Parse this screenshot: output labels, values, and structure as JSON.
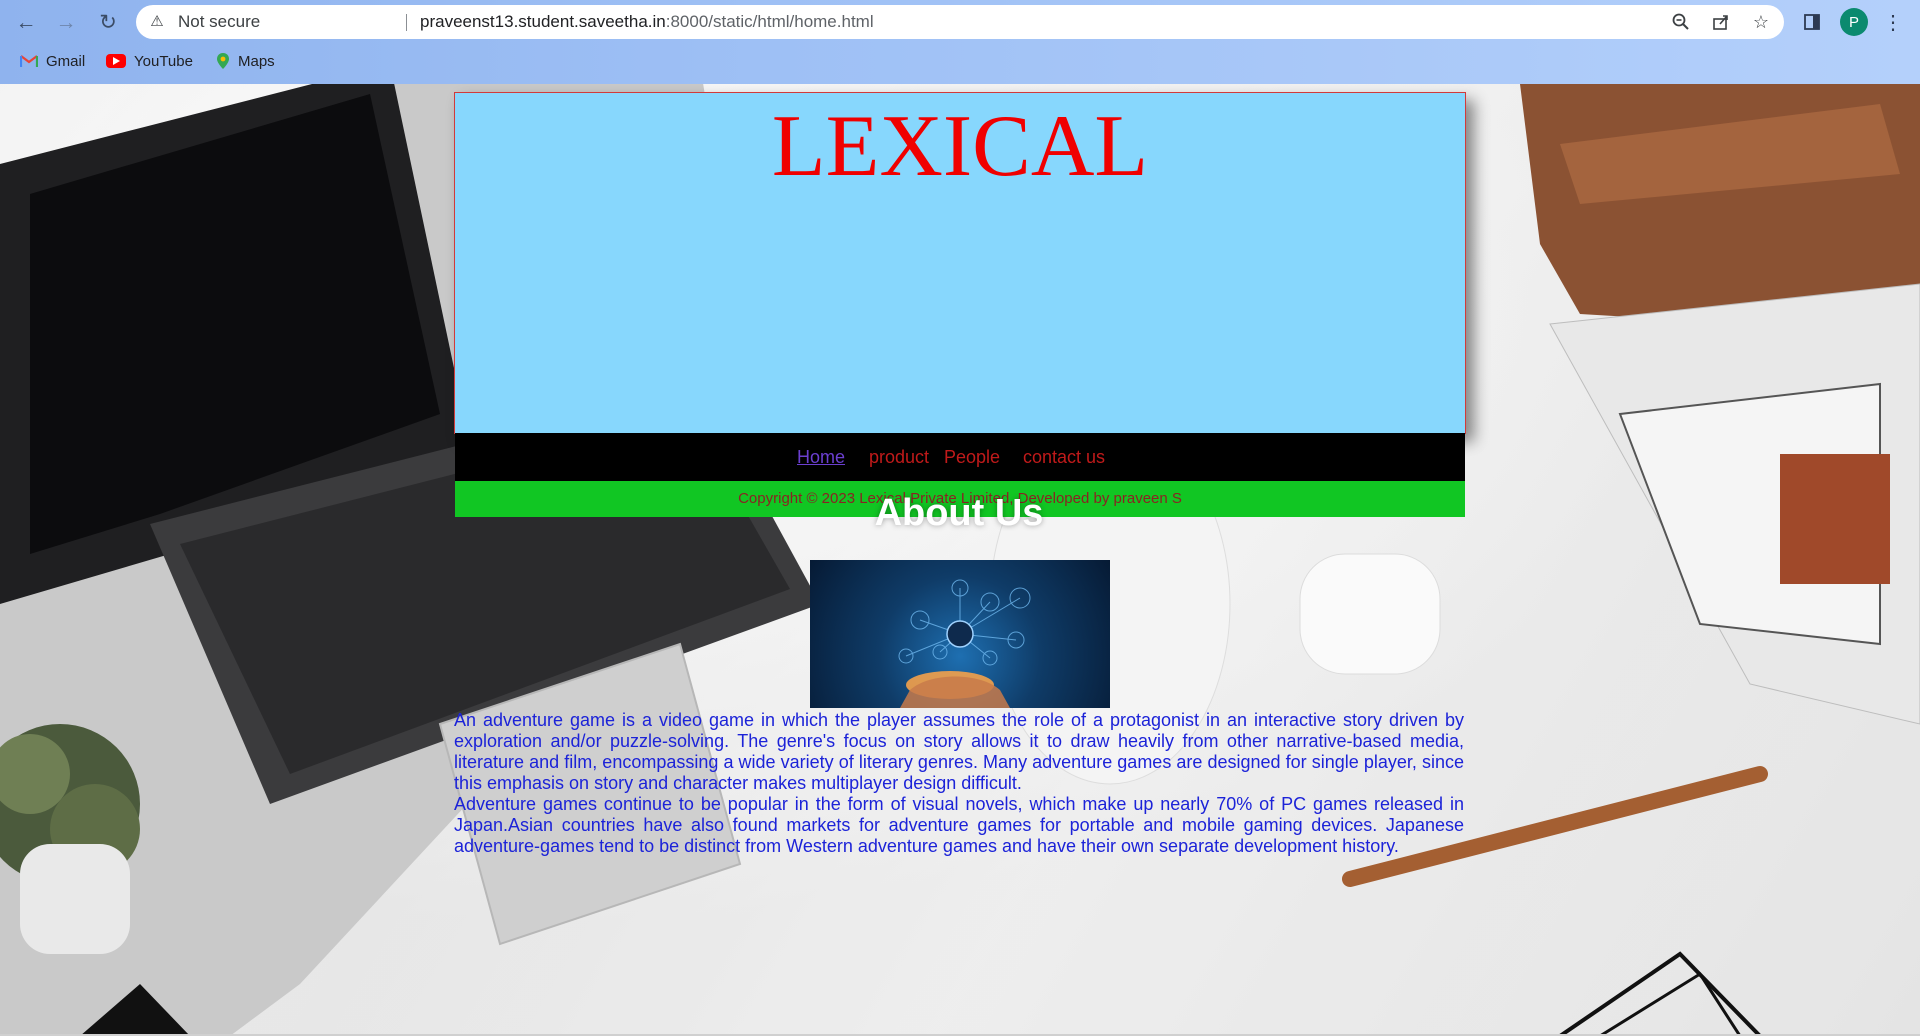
{
  "browser": {
    "security_label": "Not secure",
    "url_host": "praveenst13.student.saveetha.in",
    "url_path": ":8000/static/html/home.html",
    "profile_initial": "P",
    "bookmarks": [
      {
        "label": "Gmail",
        "icon": "gmail-icon"
      },
      {
        "label": "YouTube",
        "icon": "youtube-icon"
      },
      {
        "label": "Maps",
        "icon": "maps-icon"
      }
    ]
  },
  "page": {
    "brand": "LEXICAL",
    "nav": [
      {
        "label": "Home",
        "active": true
      },
      {
        "label": "product"
      },
      {
        "label": "People"
      },
      {
        "label": "contact us"
      }
    ],
    "copyright": "Copyright © 2023 Lexical Private Limited, Developed by praveen S",
    "about_title": "About Us",
    "about_paragraph_1": "An adventure game is a video game in which the player assumes the role of a protagonist in an interactive story driven by exploration and/or puzzle-solving. The genre's focus on story allows it to draw heavily from other narrative-based media, literature and film, encompassing a wide variety of literary genres. Many adventure games are designed for single player, since this emphasis on story and character makes multiplayer design difficult.",
    "about_paragraph_2": "Adventure games continue to be popular in the form of visual novels, which make up nearly 70% of PC games released in Japan.Asian countries have also found markets for adventure games for portable and mobile gaming devices. Japanese adventure-games tend to be distinct from Western adventure games and have their own separate development history."
  },
  "colors": {
    "header_bg": "#87d7fd",
    "brand": "#f00000",
    "menu_bg": "#000000",
    "footer_bg": "#11c623",
    "body_text": "#1c23d8"
  }
}
